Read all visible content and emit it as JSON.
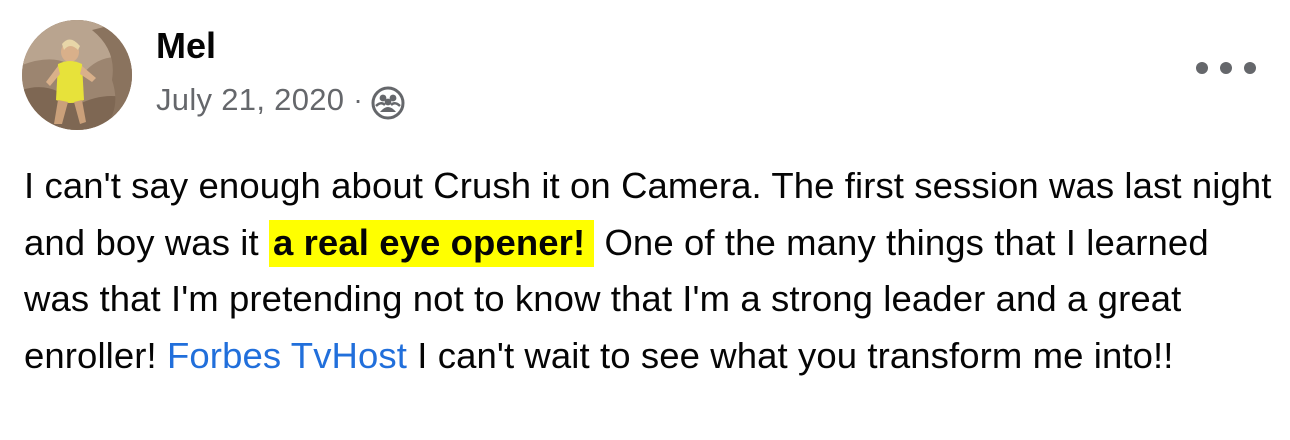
{
  "post": {
    "author": {
      "name": "Mel",
      "avatar": "profile-photo"
    },
    "date": "July 21, 2020",
    "separator": "·",
    "audience_icon": "friends-group-icon",
    "menu_icon": "more-options-icon",
    "text": {
      "part1": "I can't say enough about Crush it on Camera. The first session was last night and boy was it ",
      "highlight": "a real eye opener!",
      "part2": " One of the many things that I learned was that I'm pretending not to know that I'm a strong leader and a great enroller! ",
      "mention": "Forbes TvHost",
      "part3": " I can't wait to see what you transform me into!!"
    }
  },
  "colors": {
    "text": "#050505",
    "secondary": "#65676b",
    "link": "#216fdb",
    "highlight": "#ffff00"
  }
}
